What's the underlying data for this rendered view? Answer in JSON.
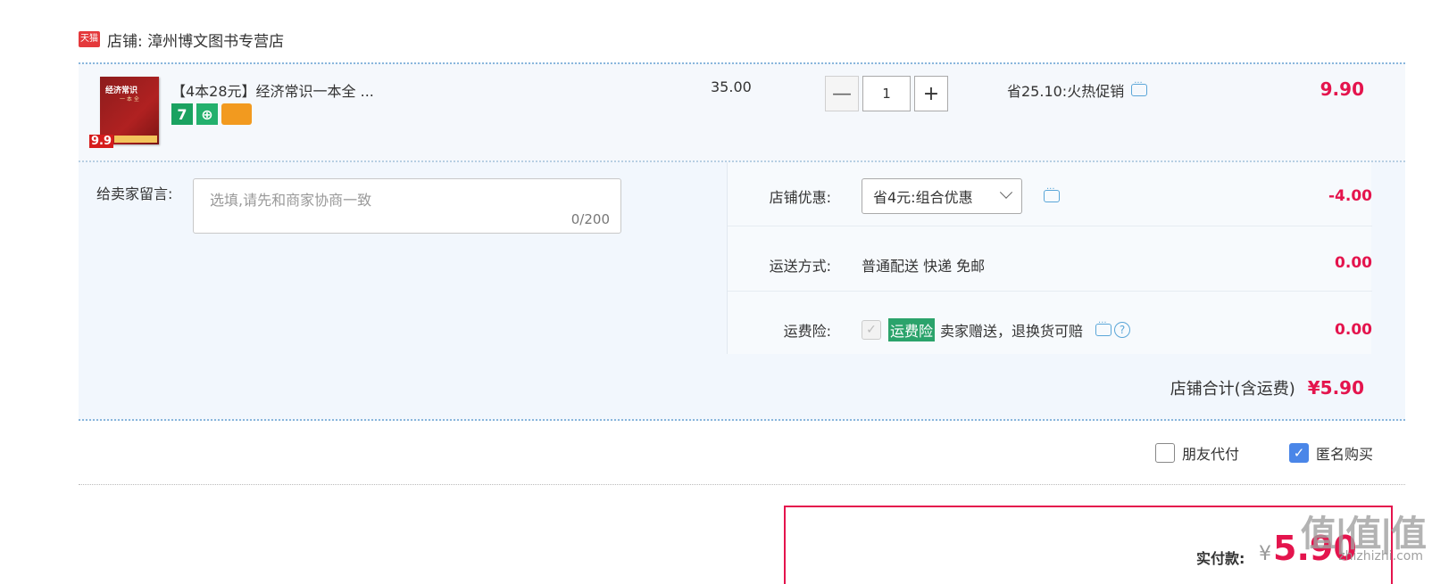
{
  "shop": {
    "badge": "天猫",
    "name": "店铺: 漳州博文图书专营店"
  },
  "item": {
    "cover_title": "经济常识",
    "cover_sub": "一 本 全",
    "cover_badge": "9.9",
    "title": "【4本28元】经济常识一本全 ...",
    "icon_7": "7",
    "icon_b": "⊕",
    "price": "35.00",
    "qty_minus": "—",
    "qty_value": "1",
    "qty_plus": "+",
    "promo": "省25.10:火热促销",
    "subtotal": "9.90"
  },
  "message": {
    "label": "给卖家留言:",
    "placeholder": "选填,请先和商家协商一致",
    "count": "0/200"
  },
  "shop_discount": {
    "label": "店铺优惠:",
    "selected": "省4元:组合优惠",
    "amount": "-4.00"
  },
  "shipping": {
    "label": "运送方式:",
    "value": "普通配送 快递 免邮",
    "amount": "0.00"
  },
  "insurance": {
    "label": "运费险:",
    "check": "✓",
    "tag": "运费险",
    "text": "卖家赠送，退换货可赔",
    "help": "?",
    "amount": "0.00"
  },
  "shop_total": {
    "label": "店铺合计(含运费)",
    "amount": "¥5.90"
  },
  "options": {
    "friend_pay": "朋友代付",
    "anonymous": "匿名购买",
    "anon_check": "✓"
  },
  "payment": {
    "label": "实付款:",
    "symbol": "¥",
    "amount": "5.90"
  },
  "watermark": {
    "text": "值|值|值",
    "url": "zhizhizhi.com"
  }
}
